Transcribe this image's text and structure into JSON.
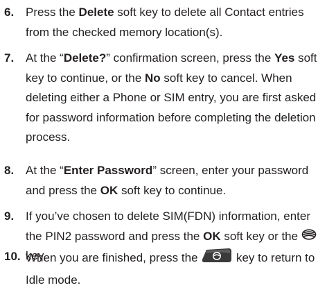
{
  "steps": [
    {
      "number": "6.",
      "parts": [
        "Press the ",
        "Delete",
        " soft key to delete all Contact entries from the checked memory location(s)."
      ]
    },
    {
      "number": "7.",
      "parts": [
        "At the “",
        "Delete?",
        "” confirmation screen, press the ",
        "Yes",
        " soft key to continue, or the ",
        "No",
        " soft key to cancel. When deleting either a Phone or SIM entry, you are first asked for password information before completing the deletion process."
      ]
    },
    {
      "number": "8.",
      "parts": [
        "At the “",
        "Enter Password",
        "” screen, enter your password and press the ",
        "OK",
        " soft key to continue."
      ]
    },
    {
      "number": "9.",
      "parts": [
        "If you’ve chosen to delete SIM(FDN) information, enter the PIN2 password and press the ",
        "OK",
        " soft key or the ",
        " key."
      ]
    },
    {
      "number": "10.",
      "parts": [
        "When you are finished, press the ",
        " key to return to Idle mode."
      ]
    }
  ],
  "icons": {
    "select_key": "menu-select-key-icon",
    "end_key": "end-key-icon"
  },
  "colors": {
    "text": "#231f20",
    "end_key_fill": "#3a3a3a"
  }
}
